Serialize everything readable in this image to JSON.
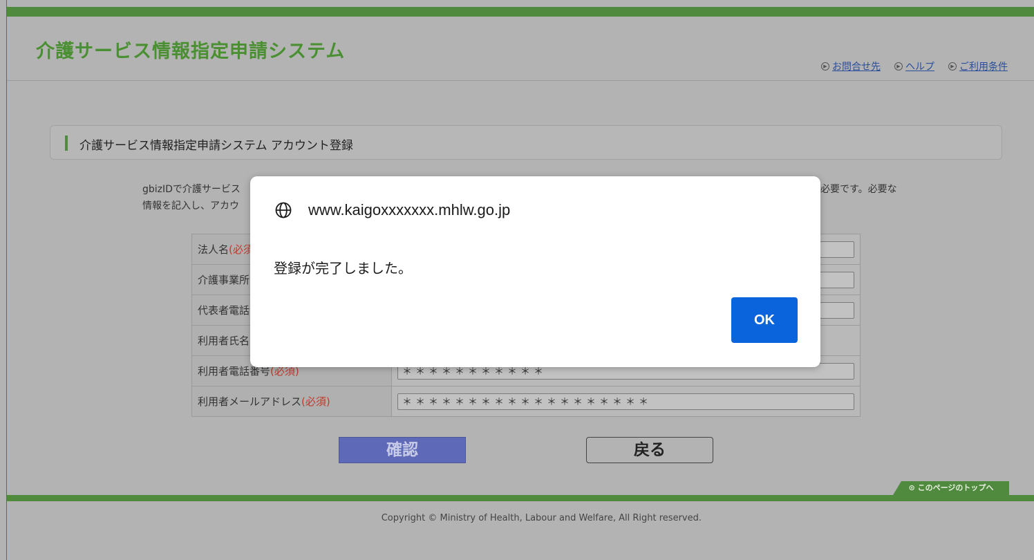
{
  "header": {
    "title": "介護サービス情報指定申請システム",
    "links": [
      "お問合せ先",
      "ヘルプ",
      "ご利用条件"
    ]
  },
  "section": {
    "title": "介護サービス情報指定申請システム アカウント登録"
  },
  "description": {
    "line1_left": "gbizIDで介護サービス",
    "line2_left": "情報を記入し、アカウ",
    "line1_right": "必要です。必要な"
  },
  "form": {
    "required_mark": "(必須)",
    "rows": [
      {
        "label": "法人名",
        "req": "(必須)",
        "value": "",
        "has_field": true
      },
      {
        "label": "介護事業所",
        "req": "",
        "value": "",
        "has_field": true
      },
      {
        "label": "代表者電話",
        "req": "",
        "value": "",
        "has_field": true
      },
      {
        "label": "利用者氏名",
        "req": "",
        "value": "",
        "has_field": false
      },
      {
        "label": "利用者電話番号",
        "req": "(必須)",
        "value": "＊＊＊＊＊＊＊＊＊＊＊",
        "has_field": true
      },
      {
        "label": "利用者メールアドレス",
        "req": "(必須)",
        "value": "＊＊＊＊＊＊＊＊＊＊＊＊＊＊＊＊＊＊＊",
        "has_field": true
      }
    ]
  },
  "buttons": {
    "confirm": "確認",
    "back": "戻る"
  },
  "pagetop": "このページのトップへ",
  "footer": {
    "copyright": "Copyright © Ministry of Health, Labour and Welfare, All Right reserved."
  },
  "dialog": {
    "host": "www.kaigoxxxxxxx.mhlw.go.jp",
    "message": "登録が完了しました。",
    "ok_label": "OK",
    "icon": "globe-icon"
  },
  "colors": {
    "accent_green": "#4f8a3e",
    "ok_blue": "#0a64dc",
    "confirm_button": "#5e6ab8",
    "required_red": "#c0392b"
  }
}
